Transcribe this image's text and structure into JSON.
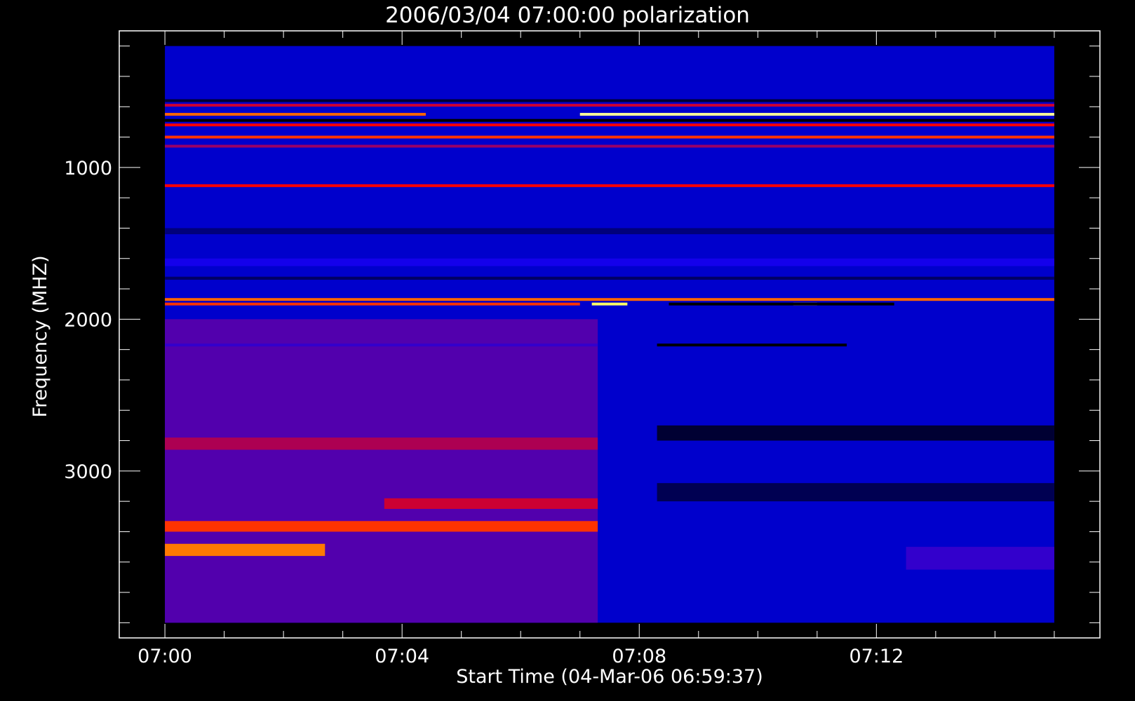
{
  "chart_data": {
    "type": "heatmap",
    "title": "2006/03/04 07:00:00 polarization",
    "xlabel": "Start Time (04-Mar-06 06:59:37)",
    "ylabel": "Frequency (MHZ)",
    "x_tick_labels": [
      "07:00",
      "07:04",
      "07:08",
      "07:12"
    ],
    "y_tick_labels": [
      "1000",
      "2000",
      "3000"
    ],
    "x_range_minutes": [
      -0.77,
      15.77
    ],
    "x_major_ticks_minutes": [
      0,
      4,
      8,
      12
    ],
    "x_minor_tick_step_minutes": 1,
    "x_data_extent_minutes": [
      0,
      15
    ],
    "y_range_mhz": [
      100,
      4100
    ],
    "y_major_ticks_mhz": [
      1000,
      2000,
      3000
    ],
    "y_minor_tick_step_mhz": 200,
    "y_data_extent_mhz": [
      200,
      4000
    ],
    "y_reversed": true,
    "colormap": [
      "#000000",
      "#0000ff",
      "#ff0000",
      "#ffff00",
      "#ffffff"
    ],
    "background_color": "#000000",
    "regions": [
      {
        "t": [
          0,
          15
        ],
        "f": [
          200,
          4000
        ],
        "level": 0.2
      },
      {
        "t": [
          0,
          7.3
        ],
        "f": [
          2000,
          4000
        ],
        "level": 0.33
      },
      {
        "t": [
          0,
          7.3
        ],
        "f": [
          3330,
          3400
        ],
        "level": 0.55
      },
      {
        "t": [
          0,
          2.7
        ],
        "f": [
          3480,
          3560
        ],
        "level": 0.62
      },
      {
        "t": [
          3.7,
          7.3
        ],
        "f": [
          3180,
          3250
        ],
        "level": 0.45
      },
      {
        "t": [
          0,
          7.3
        ],
        "f": [
          2780,
          2860
        ],
        "level": 0.42
      },
      {
        "t": [
          8.3,
          15
        ],
        "f": [
          2700,
          2800
        ],
        "level": 0.05
      },
      {
        "t": [
          8.3,
          15
        ],
        "f": [
          3080,
          3200
        ],
        "level": 0.08
      },
      {
        "t": [
          12.5,
          15
        ],
        "f": [
          3500,
          3650
        ],
        "level": 0.3
      },
      {
        "t": [
          0,
          15
        ],
        "f": [
          1400,
          1440
        ],
        "level": 0.12
      },
      {
        "t": [
          0,
          15
        ],
        "f": [
          1600,
          1650
        ],
        "level": 0.27
      },
      {
        "t": [
          0,
          15
        ],
        "f": [
          1720,
          1740
        ],
        "level": 0.1
      }
    ],
    "lines": [
      {
        "t": [
          0,
          15
        ],
        "f": 1870,
        "level": 0.6
      },
      {
        "t": [
          0,
          7
        ],
        "f": 1900,
        "level": 0.55
      },
      {
        "t": [
          7.2,
          7.8
        ],
        "f": 1900,
        "level": 0.85
      },
      {
        "t": [
          10.6,
          11.0
        ],
        "f": 1900,
        "level": 0.85
      },
      {
        "t": [
          8.5,
          12.3
        ],
        "f": 1900,
        "level": 0.0
      },
      {
        "t": [
          8.3,
          11.5
        ],
        "f": 2170,
        "level": 0.0
      },
      {
        "t": [
          0,
          7.3
        ],
        "f": 2170,
        "level": 0.3
      },
      {
        "t": [
          0,
          4.4
        ],
        "f": 650,
        "level": 0.6
      },
      {
        "t": [
          7.0,
          15
        ],
        "f": 650,
        "level": 0.9
      },
      {
        "t": [
          0,
          15
        ],
        "f": 690,
        "level": 0.0
      },
      {
        "t": [
          0,
          15
        ],
        "f": 720,
        "level": 0.5
      },
      {
        "t": [
          0,
          15
        ],
        "f": 800,
        "level": 0.55
      },
      {
        "t": [
          0,
          15
        ],
        "f": 560,
        "level": 0.05
      },
      {
        "t": [
          0,
          15
        ],
        "f": 590,
        "level": 0.45
      },
      {
        "t": [
          0,
          15
        ],
        "f": 860,
        "level": 0.4
      },
      {
        "t": [
          0,
          15
        ],
        "f": 1120,
        "level": 0.5
      }
    ]
  }
}
